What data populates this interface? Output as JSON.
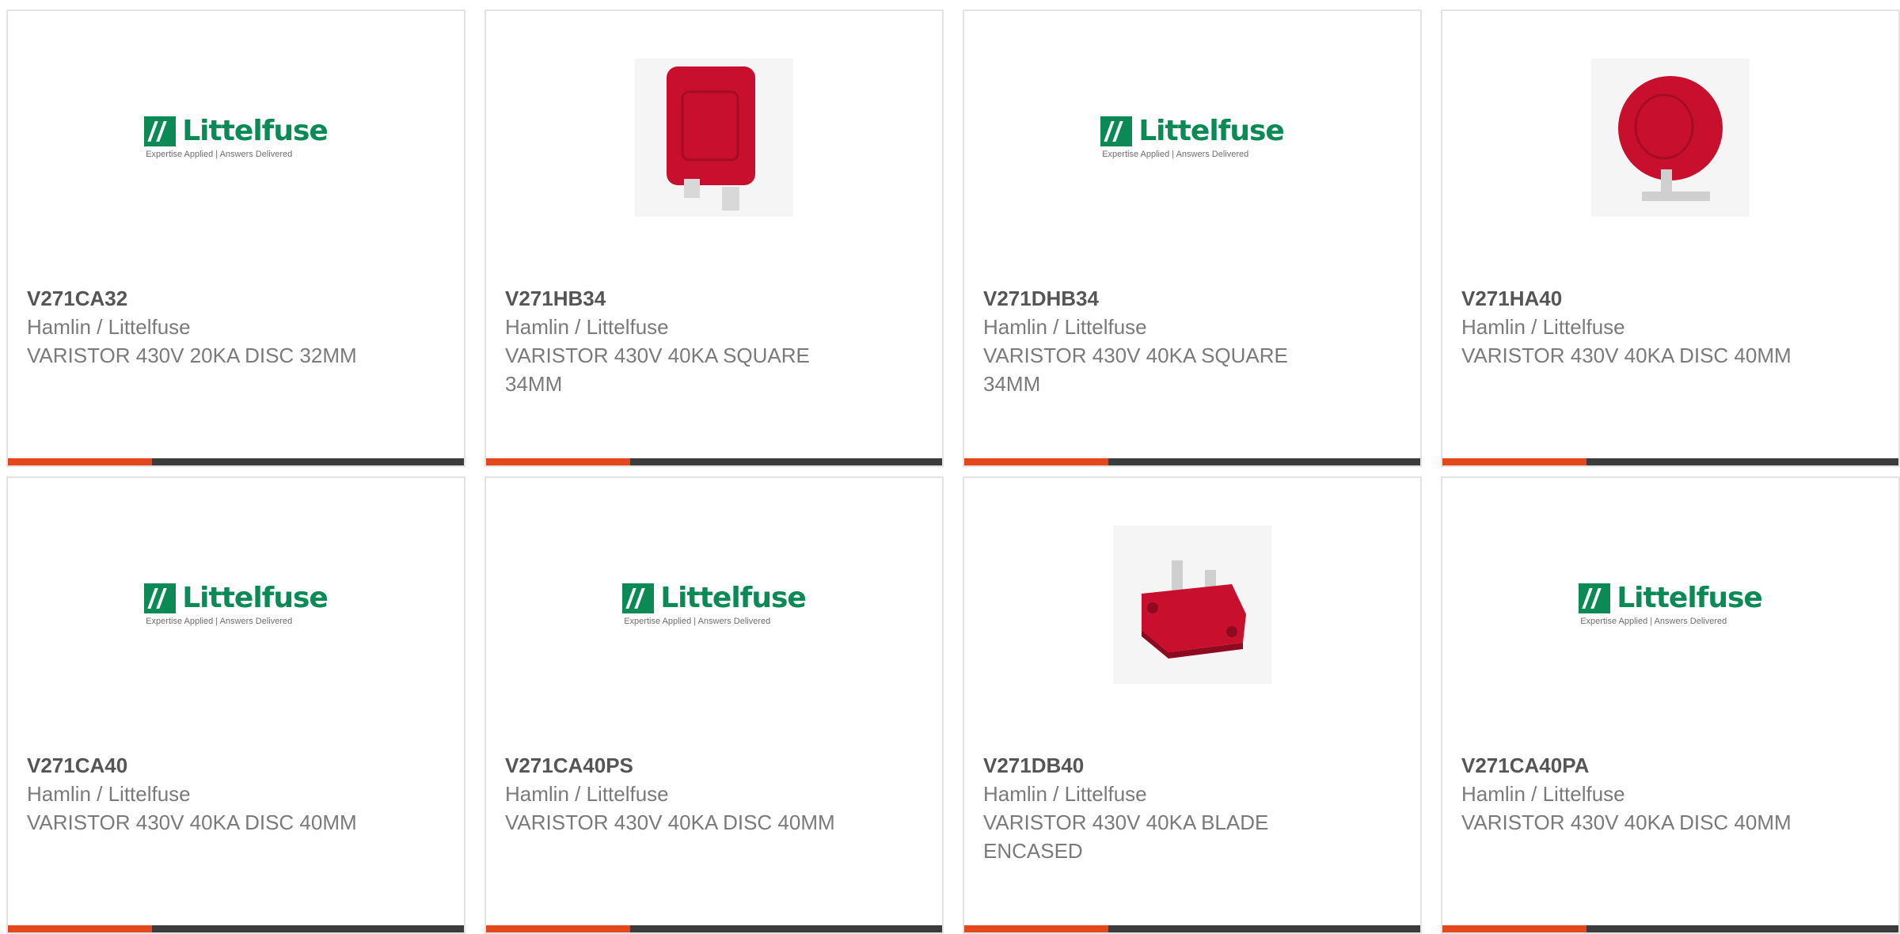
{
  "colors": {
    "accent": "#e5471c",
    "bar": "#3c3c3c",
    "brand_green": "#0b8a56",
    "product_red": "#c8102e"
  },
  "brand_logo": {
    "name": "Littelfuse",
    "tagline": "Expertise Applied | Answers Delivered"
  },
  "products": [
    {
      "part_number": "V271CA32",
      "manufacturer": "Hamlin / Littelfuse",
      "description": "VARISTOR 430V 20KA DISC 32MM",
      "image": "littelfuse-logo"
    },
    {
      "part_number": "V271HB34",
      "manufacturer": "Hamlin / Littelfuse",
      "description": "VARISTOR 430V 40KA SQUARE 34MM",
      "image": "square-varistor-photo"
    },
    {
      "part_number": "V271DHB34",
      "manufacturer": "Hamlin / Littelfuse",
      "description": "VARISTOR 430V 40KA SQUARE 34MM",
      "image": "littelfuse-logo"
    },
    {
      "part_number": "V271HA40",
      "manufacturer": "Hamlin / Littelfuse",
      "description": "VARISTOR 430V 40KA DISC 40MM",
      "image": "disc-varistor-photo"
    },
    {
      "part_number": "V271CA40",
      "manufacturer": "Hamlin / Littelfuse",
      "description": "VARISTOR 430V 40KA DISC 40MM",
      "image": "littelfuse-logo"
    },
    {
      "part_number": "V271CA40PS",
      "manufacturer": "Hamlin / Littelfuse",
      "description": "VARISTOR 430V 40KA DISC 40MM",
      "image": "littelfuse-logo"
    },
    {
      "part_number": "V271DB40",
      "manufacturer": "Hamlin / Littelfuse",
      "description": "VARISTOR 430V 40KA BLADE ENCASED",
      "image": "blade-varistor-photo"
    },
    {
      "part_number": "V271CA40PA",
      "manufacturer": "Hamlin / Littelfuse",
      "description": "VARISTOR 430V 40KA DISC 40MM",
      "image": "littelfuse-logo"
    }
  ]
}
